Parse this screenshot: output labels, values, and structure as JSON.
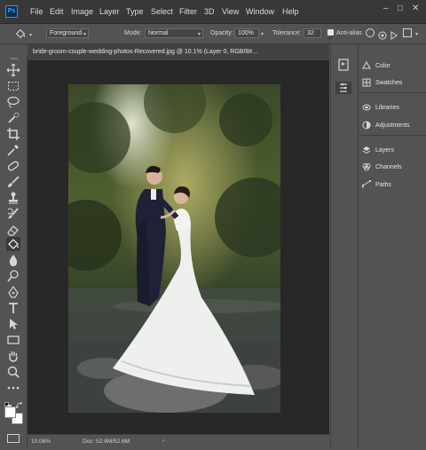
{
  "app": {
    "logo_text": "Ps"
  },
  "menu": {
    "items": [
      "File",
      "Edit",
      "Image",
      "Layer",
      "Type",
      "Select",
      "Filter",
      "3D",
      "View",
      "Window",
      "Help"
    ]
  },
  "window_controls": {
    "minimize": "–",
    "maximize": "□",
    "close": "✕"
  },
  "options_bar": {
    "tool_preset": "◆",
    "fill_source": "Foreground",
    "mode_label": "Mode:",
    "mode_value": "Normal",
    "opacity_label": "Opacity:",
    "opacity_value": "100%",
    "tolerance_label": "Tolerance:",
    "tolerance_value": "32",
    "anti_alias_label": "Anti-alias",
    "anti_alias_checked": true
  },
  "document": {
    "tab_title": "bride-groom-couple-wedding-photos-Recovered.jpg @ 10.1% (Layer 0, RGB/8#..."
  },
  "status_bar": {
    "zoom": "10.08%",
    "doc_size": "Doc: 52.6M/52.6M",
    "arrow": "›"
  },
  "panels": {
    "group1": [
      {
        "label": "Color",
        "icon": "color-wheel-icon"
      },
      {
        "label": "Swatches",
        "icon": "swatches-grid-icon"
      }
    ],
    "group2": [
      {
        "label": "Libraries",
        "icon": "libraries-icon"
      },
      {
        "label": "Adjustments",
        "icon": "adjustments-icon"
      }
    ],
    "group3": [
      {
        "label": "Layers",
        "icon": "layers-icon"
      },
      {
        "label": "Channels",
        "icon": "channels-icon"
      },
      {
        "label": "Paths",
        "icon": "paths-icon"
      }
    ]
  },
  "colors": {
    "ui_dark": "#383838",
    "ui_mid": "#535353",
    "canvas_bg": "#282828",
    "accent": "#31a8ff"
  }
}
